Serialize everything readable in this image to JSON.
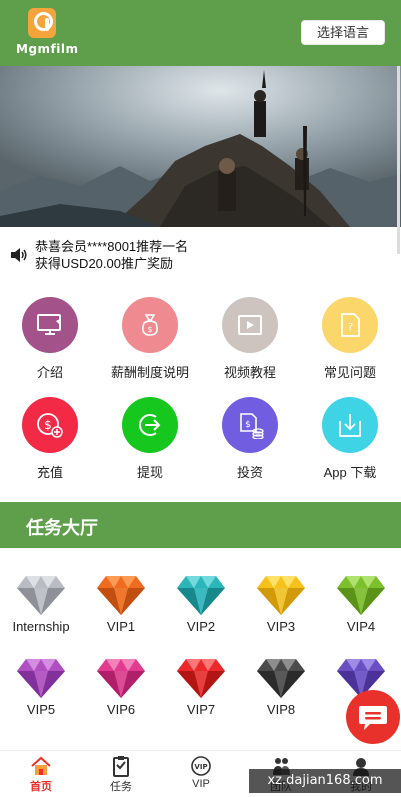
{
  "header": {
    "logo_text": "Mgmfilm",
    "language_button": "选择语言"
  },
  "notice": {
    "line1": "恭喜会员****8001推荐一名",
    "line2": "获得USD20.00推广奖励"
  },
  "menu": [
    {
      "label": "介绍",
      "icon": "monitor-icon",
      "color": "#a3528a"
    },
    {
      "label": "薪酬制度说明",
      "icon": "money-bag-icon",
      "color": "#f08a91"
    },
    {
      "label": "视频教程",
      "icon": "video-icon",
      "color": "#cdc4bf"
    },
    {
      "label": "常见问题",
      "icon": "question-doc-icon",
      "color": "#fbd66a"
    },
    {
      "label": "充值",
      "icon": "recharge-icon",
      "color": "#f32a45"
    },
    {
      "label": "提现",
      "icon": "withdraw-icon",
      "color": "#16c81e"
    },
    {
      "label": "投资",
      "icon": "invest-icon",
      "color": "#705de0"
    },
    {
      "label": "App 下载",
      "icon": "download-icon",
      "color": "#3fd3e6"
    }
  ],
  "task_hall": {
    "title": "任务大厅"
  },
  "levels": [
    {
      "label": "Internship",
      "color": "#b9bcc2"
    },
    {
      "label": "VIP1",
      "color": "#f06a1f"
    },
    {
      "label": "VIP2",
      "color": "#2bb6b9"
    },
    {
      "label": "VIP3",
      "color": "#f6c21a"
    },
    {
      "label": "VIP4",
      "color": "#7cc02c"
    },
    {
      "label": "VIP5",
      "color": "#b04fc2"
    },
    {
      "label": "VIP6",
      "color": "#e23a8e"
    },
    {
      "label": "VIP7",
      "color": "#ea2a2a"
    },
    {
      "label": "VIP8",
      "color": "#4b4b4b"
    },
    {
      "label": "",
      "color": "#6a4fc4"
    }
  ],
  "tabbar": {
    "items": [
      {
        "label": "首页",
        "icon": "home-icon"
      },
      {
        "label": "任务",
        "icon": "task-icon"
      },
      {
        "label": "VIP",
        "icon": "vip-icon"
      },
      {
        "label": "团队",
        "icon": "team-icon"
      },
      {
        "label": "我的",
        "icon": "user-icon"
      }
    ]
  },
  "watermark": "xz.dajian168.com",
  "colors": {
    "brand_green": "#5f9f4b",
    "active_red": "#e8312a"
  }
}
